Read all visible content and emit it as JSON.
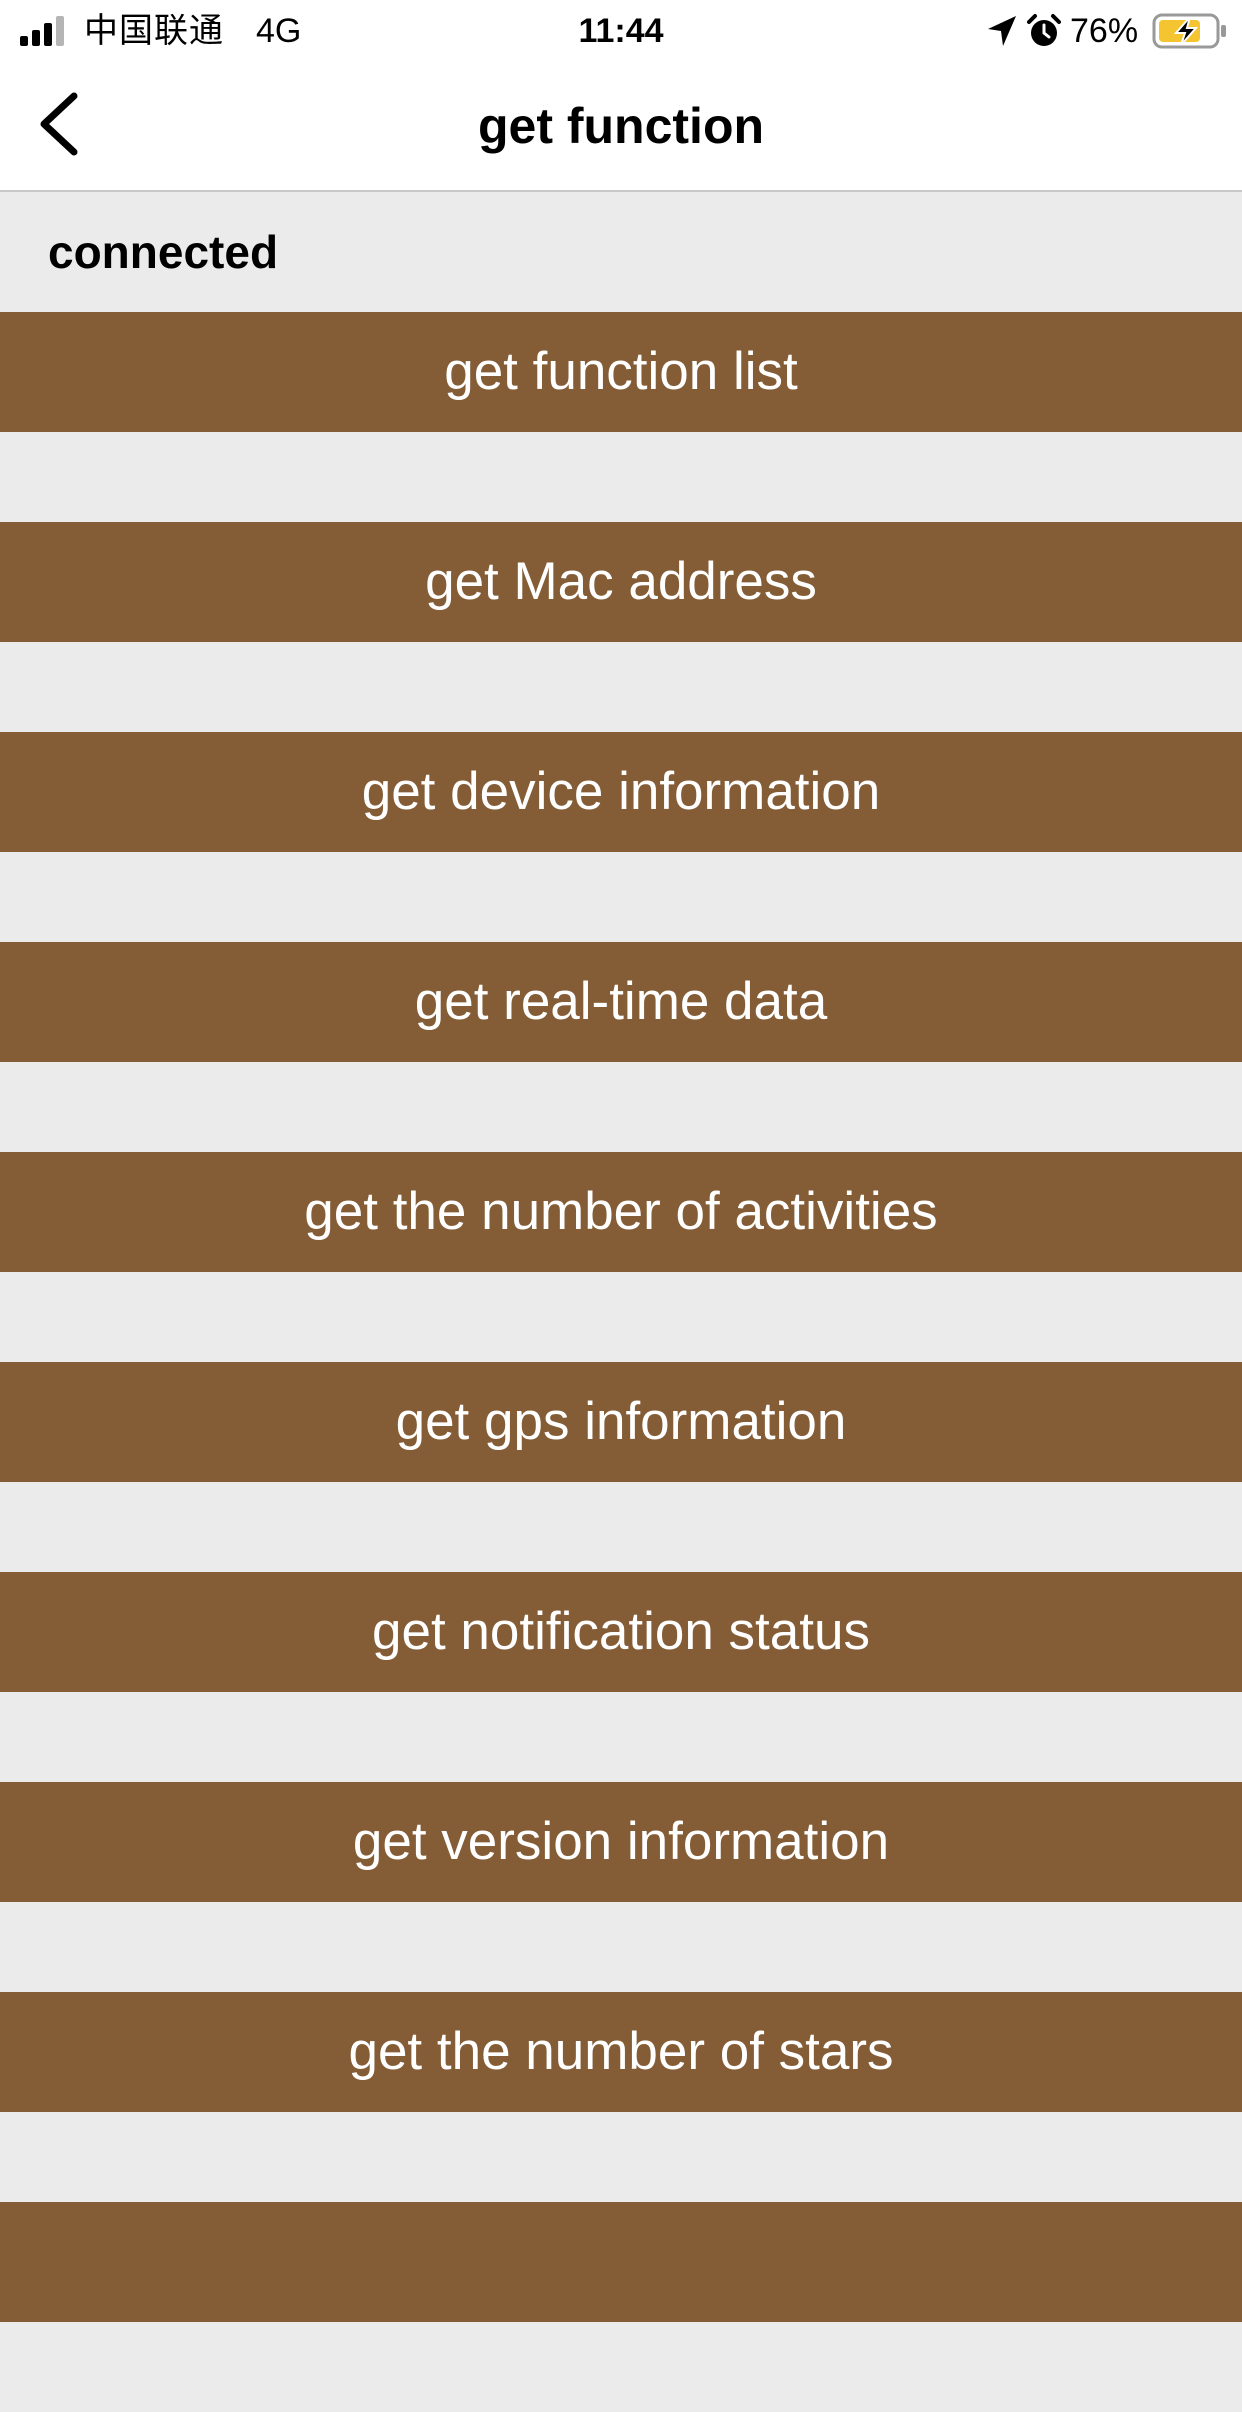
{
  "status_bar": {
    "carrier": "中国联通",
    "network": "4G",
    "time": "11:44",
    "battery_percent": "76%",
    "icons": [
      "signal-bars-icon",
      "location-arrow-icon",
      "alarm-clock-icon",
      "battery-charging-icon"
    ],
    "battery_fill_fraction": 0.76
  },
  "nav": {
    "title": "get function",
    "back_icon": "chevron-left-icon"
  },
  "connection_status": "connected",
  "buttons": [
    "get function list",
    "get Mac address",
    "get device information",
    "get real-time data",
    "get the number of activities",
    "get gps information",
    "get notification status",
    "get version information",
    "get the number of stars",
    ""
  ],
  "colors": {
    "button_background": "#845c35",
    "button_text": "#ffffff",
    "page_background": "#ebebeb",
    "battery_fill": "#f5c431"
  }
}
